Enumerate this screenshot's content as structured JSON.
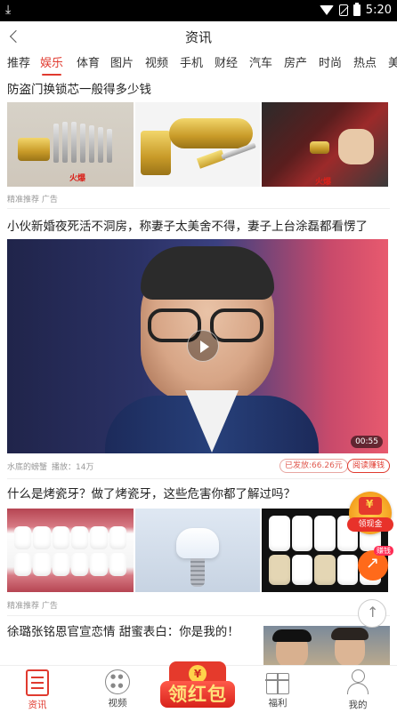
{
  "status_bar": {
    "time": "5:20",
    "download_glyph": "⤓"
  },
  "header": {
    "title": "资讯"
  },
  "tabs": [
    {
      "label": "推荐"
    },
    {
      "label": "娱乐",
      "active": true
    },
    {
      "label": "体育"
    },
    {
      "label": "图片"
    },
    {
      "label": "视频"
    },
    {
      "label": "手机"
    },
    {
      "label": "财经"
    },
    {
      "label": "汽车"
    },
    {
      "label": "房产"
    },
    {
      "label": "时尚"
    },
    {
      "label": "热点"
    },
    {
      "label": "美"
    }
  ],
  "feed": [
    {
      "headline": "防盗门换锁芯一般得多少钱",
      "meta": "精准推荐  广告",
      "watermark": "火爆",
      "watermark2": "火爆"
    },
    {
      "headline": "小伙新婚夜死活不洞房，称妻子太美舍不得，妻子上台涂磊都看愣了",
      "source": "水底的螃蟹",
      "plays": "播放：14万",
      "duration": "00:55",
      "paid": "已发放:66.26元",
      "read_earn": "阅读赚钱"
    },
    {
      "headline": "什么是烤瓷牙？做了烤瓷牙，这些危害你都了解过吗？",
      "meta": "精准推荐  广告"
    },
    {
      "headline": "徐璐张铭恩官宣恋情 甜蜜表白：你是我的！"
    }
  ],
  "floating": {
    "ling_hongbao_label": "领现金",
    "ling_coin": "¥",
    "earn_badge": "赚钱"
  },
  "bottom_nav": [
    {
      "label": "资讯",
      "icon": "news-icon",
      "active": true
    },
    {
      "label": "视频",
      "icon": "video-icon"
    },
    {
      "label": "福利",
      "icon": "gift-icon"
    },
    {
      "label": "我的",
      "icon": "profile-icon"
    }
  ],
  "red_packet": {
    "label": "领红包",
    "coin": "¥"
  },
  "colors": {
    "accent": "#e03a2f",
    "fab_orange": "#ff6a1a",
    "gold": "#f4a020"
  }
}
